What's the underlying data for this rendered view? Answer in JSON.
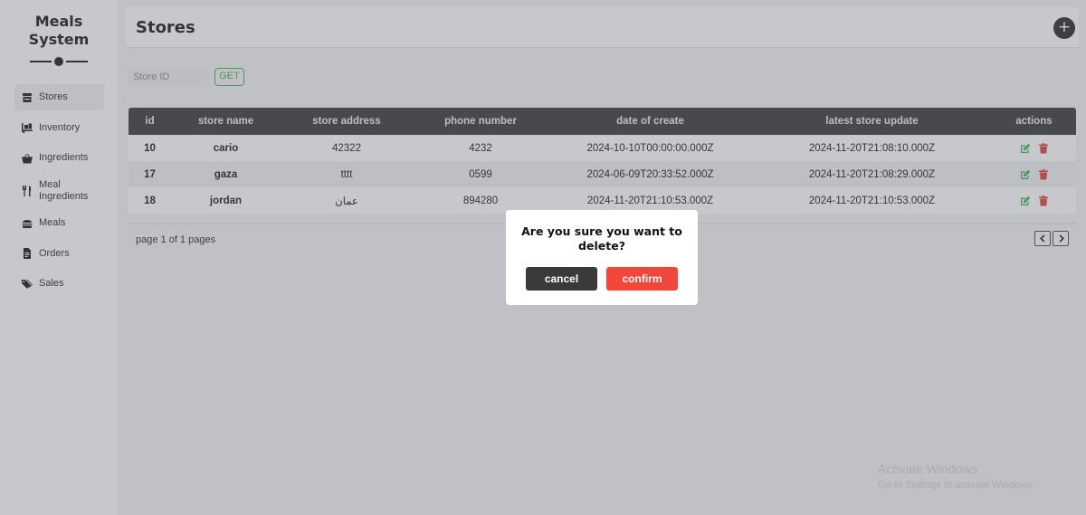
{
  "app": {
    "brand_line1": "Meals",
    "brand_line2": "System"
  },
  "sidebar": {
    "items": [
      {
        "label": "Stores",
        "icon": "store-icon",
        "active": true
      },
      {
        "label": "Inventory",
        "icon": "truck-loading-icon"
      },
      {
        "label": "Ingredients",
        "icon": "shopping-basket-icon"
      },
      {
        "label": "Meal Ingredients",
        "icon": "utensils-icon"
      },
      {
        "label": "Meals",
        "icon": "burger-icon"
      },
      {
        "label": "Orders",
        "icon": "receipt-icon"
      },
      {
        "label": "Sales",
        "icon": "tags-icon"
      }
    ]
  },
  "header": {
    "title": "Stores",
    "add_label": "+"
  },
  "search": {
    "placeholder": "Store ID",
    "value": "",
    "button_label": "GET"
  },
  "table": {
    "columns": [
      "id",
      "store name",
      "store address",
      "phone number",
      "date of create",
      "latest store update",
      "actions"
    ],
    "rows": [
      {
        "id": "10",
        "name": "cario",
        "address": "42322",
        "phone": "4232",
        "created": "2024-10-10T00:00:00.000Z",
        "updated": "2024-11-20T21:08:10.000Z"
      },
      {
        "id": "17",
        "name": "gaza",
        "address": "tttt",
        "phone": "0599",
        "created": "2024-06-09T20:33:52.000Z",
        "updated": "2024-11-20T21:08:29.000Z"
      },
      {
        "id": "18",
        "name": "jordan",
        "address": "عمان",
        "phone": "894280",
        "created": "2024-11-20T21:10:53.000Z",
        "updated": "2024-11-20T21:10:53.000Z"
      }
    ]
  },
  "pagination": {
    "text": "page 1 of 1 pages"
  },
  "modal": {
    "message": "Are you sure you want to delete?",
    "cancel_label": "cancel",
    "confirm_label": "confirm"
  },
  "watermark": {
    "title": "Activate Windows",
    "subtitle": "Go to Settings to activate Windows."
  },
  "colors": {
    "accent_green": "#3fb14f",
    "danger_red": "#f2463a",
    "header_dark": "#333333",
    "edit_green": "#2bb24c",
    "delete_red": "#e53935"
  }
}
